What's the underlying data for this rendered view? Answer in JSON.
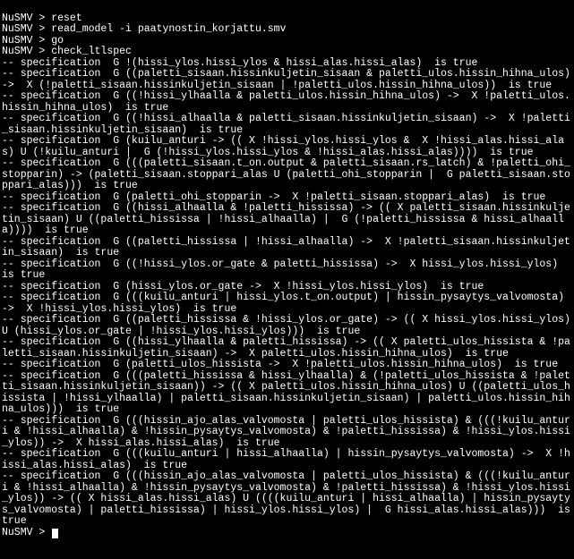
{
  "prompt": "NuSMV > ",
  "cmd_reset": "reset",
  "cmd_read": "read_model -i paatynostin_korjattu.smv",
  "cmd_go": "go",
  "cmd_check": "check_ltlspec",
  "lines": [
    "-- specification  G !(hissi_ylos.hissi_ylos & hissi_alas.hissi_alas)  is true",
    "-- specification  G ((paletti_sisaan.hissinkuljetin_sisaan & paletti_ulos.hissin_hihna_ulos) ->  X (!paletti_sisaan.hissinkuljetin_sisaan | !paletti_ulos.hissin_hihna_ulos))  is true",
    "-- specification  G ((!hissi_ylhaalla & paletti_ulos.hissin_hihna_ulos) ->  X !paletti_ulos.hissin_hihna_ulos)  is true",
    "-- specification  G ((!hissi_alhaalla & paletti_sisaan.hissinkuljetin_sisaan) ->  X !paletti_sisaan.hissinkuljetin_sisaan)  is true",
    "-- specification  G (kuilu_anturi -> (( X !hissi_ylos.hissi_ylos &  X !hissi_alas.hissi_alas) U (!kuilu_anturi |  G (!hissi_ylos.hissi_ylos & !hissi_alas.hissi_alas))))  is true",
    "-- specification  G (((paletti_sisaan.t_on.output & paletti_sisaan.rs_latch) & !paletti_ohi_stopparin) -> (paletti_sisaan.stoppari_alas U (paletti_ohi_stopparin |  G paletti_sisaan.stoppari_alas)))  is true",
    "-- specification  G (paletti_ohi_stopparin ->  X !paletti_sisaan.stoppari_alas)  is true",
    "-- specification  G ((hissi_alhaalla & !paletti_hississa) -> (( X paletti_sisaan.hissinkuljetin_sisaan) U ((paletti_hississa | !hissi_alhaalla) |  G (!paletti_hississa & hissi_alhaalla))))  is true",
    "-- specification  G ((paletti_hississa | !hissi_alhaalla) ->  X !paletti_sisaan.hissinkuljetin_sisaan)  is true",
    "-- specification  G ((!hissi_ylos.or_gate & paletti_hississa) ->  X hissi_ylos.hissi_ylos)  is true",
    "-- specification  G (hissi_ylos.or_gate ->  X !hissi_ylos.hissi_ylos)  is true",
    "-- specification  G (((kuilu_anturi | hissi_ylos.t_on.output) | hissin_pysaytys_valvomosta) ->  X !hissi_ylos.hissi_ylos)  is true",
    "-- specification  G ((paletti_hississa & !hissi_ylos.or_gate) -> (( X hissi_ylos.hissi_ylos) U (hissi_ylos.or_gate | !hissi_ylos.hissi_ylos)))  is true",
    "-- specification  G ((hissi_ylhaalla & paletti_hississa) -> (( X paletti_ulos_hissista & !paletti_sisaan.hissinkuljetin_sisaan) ->  X paletti_ulos.hissin_hihna_ulos)  is true",
    "-- specification  G (paletti_ulos_hissista ->  X !paletti_ulos.hissin_hihna_ulos)  is true",
    "-- specification  G (((paletti_hississa & hissi_ylhaalla) & (!paletti_ulos_hissista & !paletti_sisaan.hissinkuljetin_sisaan)) -> (( X paletti_ulos.hissin_hihna_ulos) U ((paletti_ulos_hissista | !hissi_ylhaalla) | paletti_sisaan.hissinkuljetin_sisaan) | paletti_ulos.hissin_hihna_ulos)))  is true",
    "-- specification  G (((hissin_ajo_alas_valvomosta | paletti_ulos_hissista) & (((!kuilu_anturi & !hissi_alhaalla) & !hissin_pysaytys_valvomosta) & !paletti_hississa) & !hissi_ylos.hissi_ylos)) ->  X hissi_alas.hissi_alas)  is true",
    "-- specification  G (((kuilu_anturi | hissi_alhaalla) | hissin_pysaytys_valvomosta) ->  X !hissi_alas.hissi_alas)  is true",
    "-- specification  G (((hissin_ajo_alas_valvomosta | paletti_ulos_hissista) & (((!kuilu_anturi & !hissi_alhaalla) & !hissin_pysaytys_valvomosta) & !paletti_hississa) & !hissi_ylos.hissi_ylos)) -> (( X hissi_alas.hissi_alas) U ((((kuilu_anturi | hissi_alhaalla) | hissin_pysaytys_valvomosta) | paletti_hississa) | hissi_ylos.hissi_ylos) |  G hissi_alas.hissi_alas)))  is true"
  ]
}
